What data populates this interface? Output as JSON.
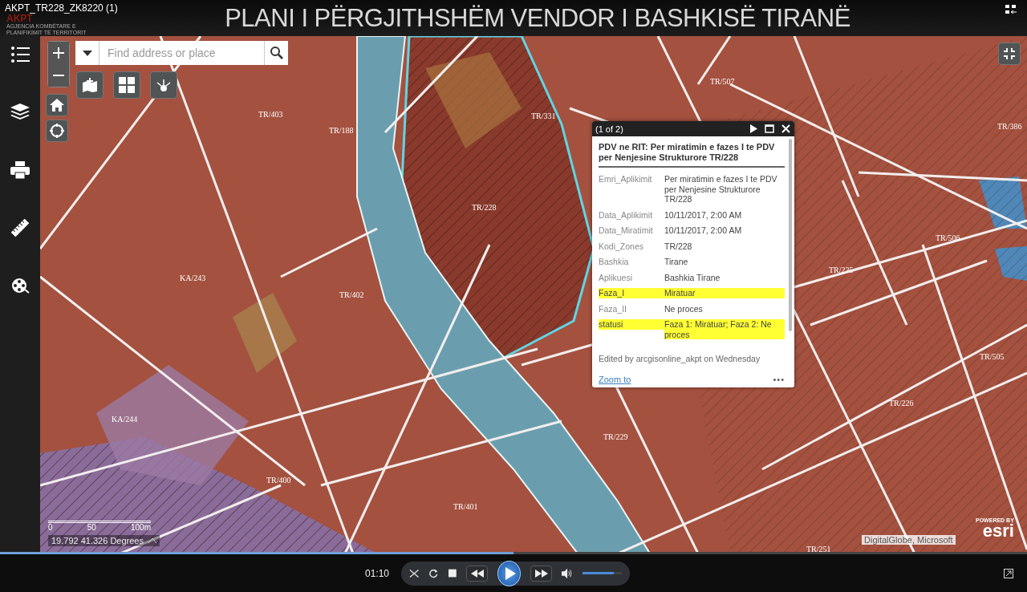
{
  "player": {
    "file_title": "AKPT_TR228_ZK8220 (1)",
    "time": "01:10",
    "progress": {
      "level": 0.5
    },
    "volume": {
      "level": 0.8
    }
  },
  "header": {
    "logo": "AKPT",
    "logo_subtitle": "AGJENCIA KOMBËTARE E PLANIFIKIMIT TË TERRITORIT",
    "title": "PLANI I PËRGJITHSHËM VENDOR I BASHKISË TIRANË"
  },
  "search": {
    "placeholder": "Find address or place"
  },
  "map_labels": [
    "TR/403",
    "TR/188",
    "TR/507",
    "TR/386",
    "TR/331",
    "TR/228",
    "KA/243",
    "TR/402",
    "TR/506",
    "TR/225",
    "TR/505",
    "TR/226",
    "KA/244",
    "TR/229",
    "TR/400",
    "TR/401",
    "TR/251"
  ],
  "popup": {
    "counter": "(1 of 2)",
    "title": "PDV ne RIT: Per miratimin e fazes I te PDV per Nenjesine Strukturore TR/228",
    "fields": [
      {
        "label": "Emri_Aplikimit",
        "value": "Per miratimin e fazes I te PDV per Nenjesine Strukturore TR/228",
        "highlighted": false
      },
      {
        "label": "Data_Aplikimit",
        "value": "10/11/2017, 2:00 AM",
        "highlighted": false
      },
      {
        "label": "Data_Miratimit",
        "value": "10/11/2017, 2:00 AM",
        "highlighted": false
      },
      {
        "label": "Kodi_Zones",
        "value": "TR/228",
        "highlighted": false
      },
      {
        "label": "Bashkia",
        "value": "Tirane",
        "highlighted": false
      },
      {
        "label": "Aplikuesi",
        "value": "Bashkia Tirane",
        "highlighted": false
      },
      {
        "label": "Faza_I",
        "value": "Miratuar",
        "highlighted": true
      },
      {
        "label": "Faza_II",
        "value": "Ne proces",
        "highlighted": false
      },
      {
        "label": "statusi",
        "value": "Faza 1: Miratuar; Faza 2: Ne proces",
        "highlighted": true
      }
    ],
    "footer": "Edited by arcgisonline_akpt on Wednesday",
    "zoom_link": "Zoom to",
    "menu": "•••"
  },
  "scale": {
    "ticks": [
      "0",
      "50",
      "100m"
    ]
  },
  "coordinates": "19.792 41.326 Degrees",
  "attribution": "DigitalGlobe, Microsoft",
  "esri": {
    "powered": "POWERED BY",
    "brand": "esri"
  }
}
